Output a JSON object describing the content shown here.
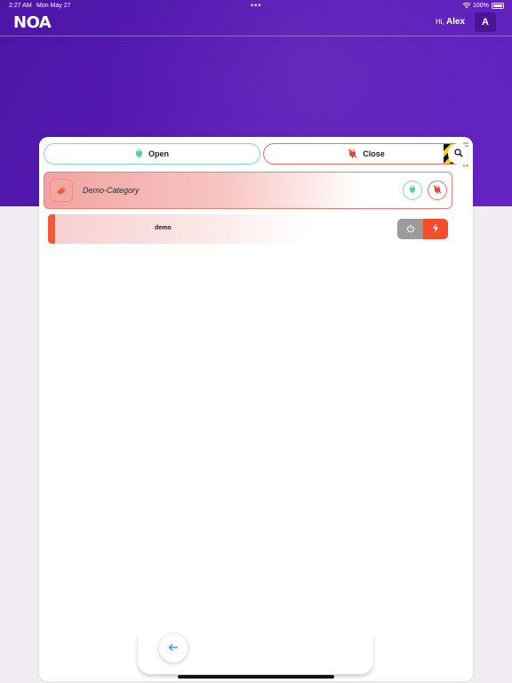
{
  "status": {
    "time": "2:27 AM",
    "date": "Mon May 27",
    "battery": "100%"
  },
  "header": {
    "logo": "NOA",
    "greeting": "Hi,",
    "user_name": "Alex",
    "avatar_initial": "A"
  },
  "actions": {
    "open_label": "Open",
    "close_label": "Close"
  },
  "category": {
    "name": "Demo-Category"
  },
  "devices": [
    {
      "name": "demo"
    }
  ],
  "icons": {
    "open": "plug-icon",
    "close": "unplug-icon",
    "search": "search-icon",
    "back": "arrow-left-icon",
    "power": "power-icon",
    "flash": "lightning-icon",
    "category": "eraser-icon"
  },
  "colors": {
    "header": "#5a1ab5",
    "open_accent": "#7dd8c2",
    "close_accent": "#ef6b63",
    "device_accent": "#f05a38"
  }
}
